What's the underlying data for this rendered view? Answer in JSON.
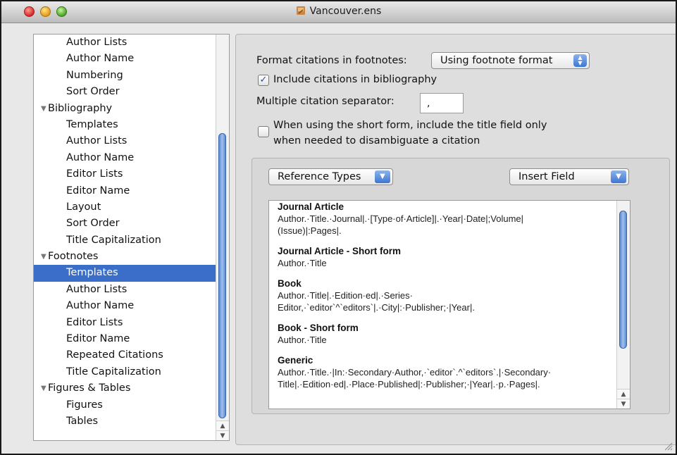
{
  "window": {
    "title": "Vancouver.ens"
  },
  "sidebar": {
    "items": [
      {
        "label": "Author Lists",
        "kind": "child"
      },
      {
        "label": "Author Name",
        "kind": "child"
      },
      {
        "label": "Numbering",
        "kind": "child"
      },
      {
        "label": "Sort Order",
        "kind": "child"
      },
      {
        "label": "Bibliography",
        "kind": "group"
      },
      {
        "label": "Templates",
        "kind": "child"
      },
      {
        "label": "Author Lists",
        "kind": "child"
      },
      {
        "label": "Author Name",
        "kind": "child"
      },
      {
        "label": "Editor Lists",
        "kind": "child"
      },
      {
        "label": "Editor Name",
        "kind": "child"
      },
      {
        "label": "Layout",
        "kind": "child"
      },
      {
        "label": "Sort Order",
        "kind": "child"
      },
      {
        "label": "Title Capitalization",
        "kind": "child"
      },
      {
        "label": "Footnotes",
        "kind": "group"
      },
      {
        "label": "Templates",
        "kind": "child",
        "selected": true
      },
      {
        "label": "Author Lists",
        "kind": "child"
      },
      {
        "label": "Author Name",
        "kind": "child"
      },
      {
        "label": "Editor Lists",
        "kind": "child"
      },
      {
        "label": "Editor Name",
        "kind": "child"
      },
      {
        "label": "Repeated Citations",
        "kind": "child"
      },
      {
        "label": "Title Capitalization",
        "kind": "child"
      },
      {
        "label": "Figures & Tables",
        "kind": "group"
      },
      {
        "label": "Figures",
        "kind": "child"
      },
      {
        "label": "Tables",
        "kind": "child"
      }
    ]
  },
  "settings": {
    "format_label": "Format citations in footnotes:",
    "format_value": "Using footnote format",
    "include_bibliography_label": "Include citations in bibliography",
    "include_bibliography_checked": true,
    "separator_label": "Multiple citation separator:",
    "separator_value": ",",
    "short_form_label_line1": "When using the short form, include the title field only",
    "short_form_label_line2": "when needed to disambiguate a citation",
    "short_form_checked": false
  },
  "toolbar": {
    "reference_types_label": "Reference Types",
    "insert_field_label": "Insert Field"
  },
  "templates": [
    {
      "name": "Journal Article",
      "lines": [
        "Author.·Title.·Journal|.·[Type·of·Article]|.·Year|·Date|;Volume|",
        "(Issue)|:Pages|."
      ]
    },
    {
      "name": "Journal Article - Short form",
      "lines": [
        "Author.·Title"
      ]
    },
    {
      "name": "Book",
      "lines": [
        "Author.·Title|.·Edition·ed|.·Series·",
        "Editor,·`editor`^`editors`|.·City|:·Publisher;·|Year|."
      ]
    },
    {
      "name": "Book - Short form",
      "lines": [
        "Author.·Title"
      ]
    },
    {
      "name": "Generic",
      "lines": [
        "Author.·Title.·|In:·Secondary·Author,·`editor`.^`editors`.|·Secondary·",
        "Title|.·Edition·ed|.·Place·Published|:·Publisher;·|Year|.·p.·Pages|."
      ]
    }
  ],
  "colors": {
    "selection": "#3b6ec8",
    "scroll_thumb": "#7fa6e3",
    "accent": "#3d76d3"
  }
}
